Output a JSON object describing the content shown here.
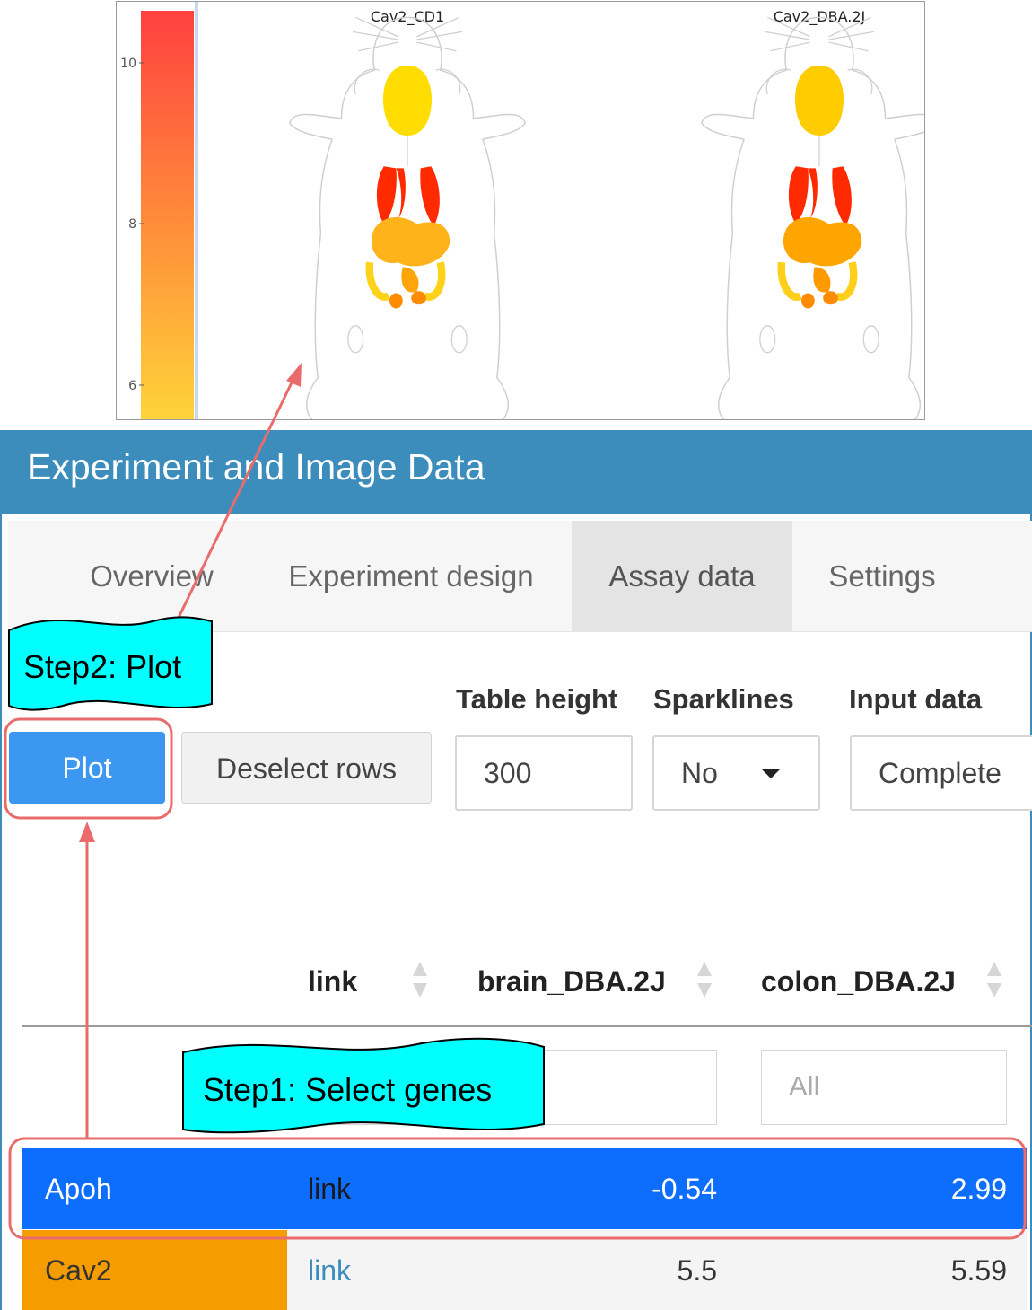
{
  "plot": {
    "left_label": "Cav2_CD1",
    "right_label": "Cav2_DBA.2J",
    "colorbar_ticks": [
      "10",
      "8",
      "6"
    ]
  },
  "panel": {
    "title": "Experiment and Image Data"
  },
  "tabs": [
    {
      "label": "Overview",
      "active": false
    },
    {
      "label": "Experiment design",
      "active": false
    },
    {
      "label": "Assay data",
      "active": true
    },
    {
      "label": "Settings",
      "active": false
    }
  ],
  "controls": {
    "plot_button": "Plot",
    "deselect_button": "Deselect rows",
    "table_height_label": "Table height",
    "table_height_value": "300",
    "sparklines_label": "Sparklines",
    "sparklines_value": "No",
    "input_data_label": "Input data",
    "input_data_value": "Complete"
  },
  "table": {
    "columns": [
      "link",
      "brain_DBA.2J",
      "colon_DBA.2J"
    ],
    "filter_placeholder": "All",
    "rows": [
      {
        "gene": "Apoh",
        "link": "link",
        "brain": "-0.54",
        "colon": "2.99",
        "selected": true
      },
      {
        "gene": "Cav2",
        "link": "link",
        "brain": "5.5",
        "colon": "5.59",
        "selected": false
      }
    ]
  },
  "annotations": {
    "step1": "Step1: Select genes",
    "step2": "Step2: Plot"
  },
  "colors": {
    "header_blue": "#3c8dbc",
    "plot_button_blue": "#3c97f0",
    "selected_row_blue": "#0d6efd",
    "cav2_highlight": "#f59c00",
    "callout_cyan": "#00ffff",
    "annotation_red": "#e96b6b",
    "organ_brain": "#ffdd00",
    "organ_lung": "#ff2a00",
    "organ_liver_left": "#ffb31a",
    "organ_liver_right": "#ffa50a",
    "organ_colon": "#ffd21a",
    "organ_kidney": "#ff8c00"
  },
  "icons": [
    "sort-arrows-icon",
    "dropdown-caret-icon"
  ]
}
